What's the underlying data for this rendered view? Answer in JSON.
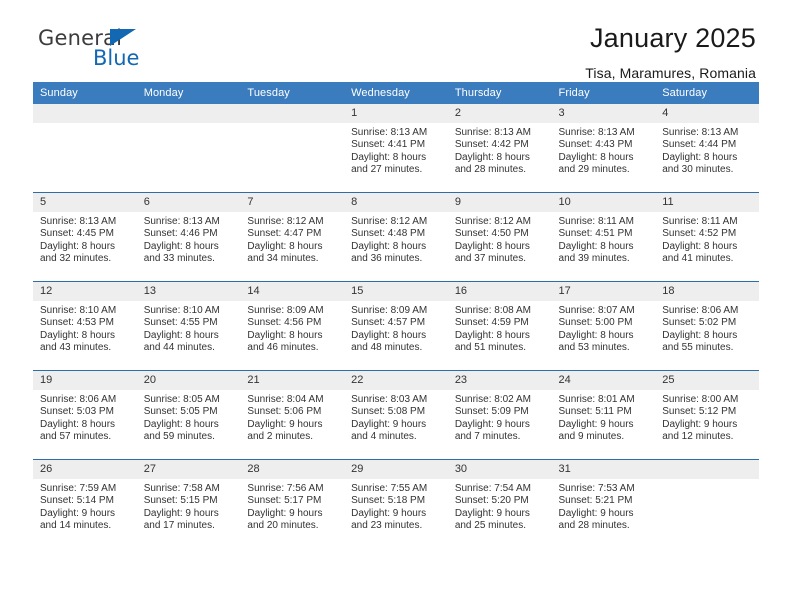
{
  "brand": {
    "name_part1": "General",
    "name_part2": "Blue",
    "logo_icon": "blue-triangle-icon"
  },
  "header": {
    "title": "January 2025",
    "location": "Tisa, Maramures, Romania"
  },
  "colors": {
    "header_blue": "#3a7cbe",
    "row_divider": "#2f6da8",
    "daynum_band": "#eeeeee",
    "brand_blue": "#1268b3"
  },
  "calendar": {
    "weekday_headers": [
      "Sunday",
      "Monday",
      "Tuesday",
      "Wednesday",
      "Thursday",
      "Friday",
      "Saturday"
    ],
    "weeks": [
      [
        {
          "day": "",
          "lines": []
        },
        {
          "day": "",
          "lines": []
        },
        {
          "day": "",
          "lines": []
        },
        {
          "day": "1",
          "lines": [
            "Sunrise: 8:13 AM",
            "Sunset: 4:41 PM",
            "Daylight: 8 hours",
            "and 27 minutes."
          ]
        },
        {
          "day": "2",
          "lines": [
            "Sunrise: 8:13 AM",
            "Sunset: 4:42 PM",
            "Daylight: 8 hours",
            "and 28 minutes."
          ]
        },
        {
          "day": "3",
          "lines": [
            "Sunrise: 8:13 AM",
            "Sunset: 4:43 PM",
            "Daylight: 8 hours",
            "and 29 minutes."
          ]
        },
        {
          "day": "4",
          "lines": [
            "Sunrise: 8:13 AM",
            "Sunset: 4:44 PM",
            "Daylight: 8 hours",
            "and 30 minutes."
          ]
        }
      ],
      [
        {
          "day": "5",
          "lines": [
            "Sunrise: 8:13 AM",
            "Sunset: 4:45 PM",
            "Daylight: 8 hours",
            "and 32 minutes."
          ]
        },
        {
          "day": "6",
          "lines": [
            "Sunrise: 8:13 AM",
            "Sunset: 4:46 PM",
            "Daylight: 8 hours",
            "and 33 minutes."
          ]
        },
        {
          "day": "7",
          "lines": [
            "Sunrise: 8:12 AM",
            "Sunset: 4:47 PM",
            "Daylight: 8 hours",
            "and 34 minutes."
          ]
        },
        {
          "day": "8",
          "lines": [
            "Sunrise: 8:12 AM",
            "Sunset: 4:48 PM",
            "Daylight: 8 hours",
            "and 36 minutes."
          ]
        },
        {
          "day": "9",
          "lines": [
            "Sunrise: 8:12 AM",
            "Sunset: 4:50 PM",
            "Daylight: 8 hours",
            "and 37 minutes."
          ]
        },
        {
          "day": "10",
          "lines": [
            "Sunrise: 8:11 AM",
            "Sunset: 4:51 PM",
            "Daylight: 8 hours",
            "and 39 minutes."
          ]
        },
        {
          "day": "11",
          "lines": [
            "Sunrise: 8:11 AM",
            "Sunset: 4:52 PM",
            "Daylight: 8 hours",
            "and 41 minutes."
          ]
        }
      ],
      [
        {
          "day": "12",
          "lines": [
            "Sunrise: 8:10 AM",
            "Sunset: 4:53 PM",
            "Daylight: 8 hours",
            "and 43 minutes."
          ]
        },
        {
          "day": "13",
          "lines": [
            "Sunrise: 8:10 AM",
            "Sunset: 4:55 PM",
            "Daylight: 8 hours",
            "and 44 minutes."
          ]
        },
        {
          "day": "14",
          "lines": [
            "Sunrise: 8:09 AM",
            "Sunset: 4:56 PM",
            "Daylight: 8 hours",
            "and 46 minutes."
          ]
        },
        {
          "day": "15",
          "lines": [
            "Sunrise: 8:09 AM",
            "Sunset: 4:57 PM",
            "Daylight: 8 hours",
            "and 48 minutes."
          ]
        },
        {
          "day": "16",
          "lines": [
            "Sunrise: 8:08 AM",
            "Sunset: 4:59 PM",
            "Daylight: 8 hours",
            "and 51 minutes."
          ]
        },
        {
          "day": "17",
          "lines": [
            "Sunrise: 8:07 AM",
            "Sunset: 5:00 PM",
            "Daylight: 8 hours",
            "and 53 minutes."
          ]
        },
        {
          "day": "18",
          "lines": [
            "Sunrise: 8:06 AM",
            "Sunset: 5:02 PM",
            "Daylight: 8 hours",
            "and 55 minutes."
          ]
        }
      ],
      [
        {
          "day": "19",
          "lines": [
            "Sunrise: 8:06 AM",
            "Sunset: 5:03 PM",
            "Daylight: 8 hours",
            "and 57 minutes."
          ]
        },
        {
          "day": "20",
          "lines": [
            "Sunrise: 8:05 AM",
            "Sunset: 5:05 PM",
            "Daylight: 8 hours",
            "and 59 minutes."
          ]
        },
        {
          "day": "21",
          "lines": [
            "Sunrise: 8:04 AM",
            "Sunset: 5:06 PM",
            "Daylight: 9 hours",
            "and 2 minutes."
          ]
        },
        {
          "day": "22",
          "lines": [
            "Sunrise: 8:03 AM",
            "Sunset: 5:08 PM",
            "Daylight: 9 hours",
            "and 4 minutes."
          ]
        },
        {
          "day": "23",
          "lines": [
            "Sunrise: 8:02 AM",
            "Sunset: 5:09 PM",
            "Daylight: 9 hours",
            "and 7 minutes."
          ]
        },
        {
          "day": "24",
          "lines": [
            "Sunrise: 8:01 AM",
            "Sunset: 5:11 PM",
            "Daylight: 9 hours",
            "and 9 minutes."
          ]
        },
        {
          "day": "25",
          "lines": [
            "Sunrise: 8:00 AM",
            "Sunset: 5:12 PM",
            "Daylight: 9 hours",
            "and 12 minutes."
          ]
        }
      ],
      [
        {
          "day": "26",
          "lines": [
            "Sunrise: 7:59 AM",
            "Sunset: 5:14 PM",
            "Daylight: 9 hours",
            "and 14 minutes."
          ]
        },
        {
          "day": "27",
          "lines": [
            "Sunrise: 7:58 AM",
            "Sunset: 5:15 PM",
            "Daylight: 9 hours",
            "and 17 minutes."
          ]
        },
        {
          "day": "28",
          "lines": [
            "Sunrise: 7:56 AM",
            "Sunset: 5:17 PM",
            "Daylight: 9 hours",
            "and 20 minutes."
          ]
        },
        {
          "day": "29",
          "lines": [
            "Sunrise: 7:55 AM",
            "Sunset: 5:18 PM",
            "Daylight: 9 hours",
            "and 23 minutes."
          ]
        },
        {
          "day": "30",
          "lines": [
            "Sunrise: 7:54 AM",
            "Sunset: 5:20 PM",
            "Daylight: 9 hours",
            "and 25 minutes."
          ]
        },
        {
          "day": "31",
          "lines": [
            "Sunrise: 7:53 AM",
            "Sunset: 5:21 PM",
            "Daylight: 9 hours",
            "and 28 minutes."
          ]
        },
        {
          "day": "",
          "lines": []
        }
      ]
    ]
  }
}
